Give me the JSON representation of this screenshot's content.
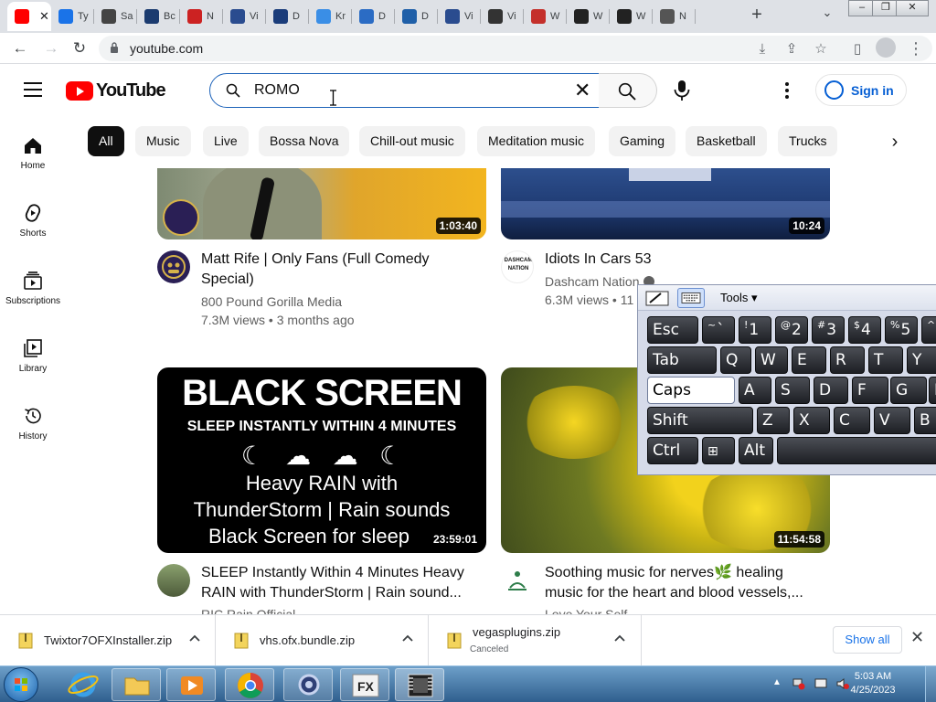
{
  "browser": {
    "tabs": [
      {
        "label": "",
        "favicon_color": "#ff0000",
        "active": true
      },
      {
        "label": "Ty",
        "favicon_color": "#1a73e8",
        "active": false
      },
      {
        "label": "Sa",
        "favicon_color": "#444444",
        "active": false
      },
      {
        "label": "Bc",
        "favicon_color": "#1b3b6f",
        "active": false
      },
      {
        "label": "N",
        "favicon_color": "#cc2222",
        "active": false
      },
      {
        "label": "Vi",
        "favicon_color": "#2a4c8f",
        "active": false
      },
      {
        "label": "D",
        "favicon_color": "#1a3c7a",
        "active": false
      },
      {
        "label": "Kr",
        "favicon_color": "#3a8ee6",
        "active": false
      },
      {
        "label": "D",
        "favicon_color": "#2b6cc4",
        "active": false
      },
      {
        "label": "D",
        "favicon_color": "#1f5fa8",
        "active": false
      },
      {
        "label": "Vi",
        "favicon_color": "#2a4c8f",
        "active": false
      },
      {
        "label": "Vi",
        "favicon_color": "#333333",
        "active": false
      },
      {
        "label": "W",
        "favicon_color": "#c4302b",
        "active": false
      },
      {
        "label": "W",
        "favicon_color": "#222222",
        "active": false
      },
      {
        "label": "W",
        "favicon_color": "#222222",
        "active": false
      },
      {
        "label": "N",
        "favicon_color": "#555555",
        "active": false
      }
    ],
    "url": "youtube.com",
    "new_tab_symbol": "+"
  },
  "youtube": {
    "logo_text": "YouTube",
    "search": {
      "value": "ROMO"
    },
    "signin_label": "Sign in",
    "chips": [
      "All",
      "Music",
      "Live",
      "Bossa Nova",
      "Chill-out music",
      "Meditation music",
      "Gaming",
      "Basketball",
      "Trucks"
    ],
    "guide": [
      {
        "label": "Home",
        "icon": "home-icon"
      },
      {
        "label": "Shorts",
        "icon": "shorts-icon"
      },
      {
        "label": "Subscriptions",
        "icon": "subscriptions-icon"
      },
      {
        "label": "Library",
        "icon": "library-icon"
      },
      {
        "label": "History",
        "icon": "history-icon"
      }
    ],
    "videos": [
      {
        "title": "Matt Rife | Only Fans (Full Comedy Special)",
        "channel": "800 Pound Gorilla Media",
        "meta": "7.3M views • 3 months ago",
        "duration": "1:03:40"
      },
      {
        "title": "Idiots In Cars 53",
        "channel": "Dashcam Nation",
        "meta": "6.3M views • 11",
        "duration": "10:24",
        "avatar_text": "DASHCAM NATION"
      },
      {
        "title": "SLEEP Instantly Within 4 Minutes Heavy RAIN with ThunderStorm | Rain sound...",
        "channel": "RIC Rain Official",
        "meta": "",
        "duration": "23:59:01",
        "thumb_lines": [
          "BLACK SCREEN",
          "SLEEP INSTANTLY WITHIN 4 MINUTES",
          "Heavy RAIN with",
          "ThunderStorm | Rain sounds",
          "Black Screen for sleep"
        ]
      },
      {
        "title": "Soothing music for nerves🌿 healing music for the heart and blood vessels,...",
        "channel": "Love Your Self",
        "meta": "",
        "duration": "11:54:58"
      }
    ]
  },
  "keyboard": {
    "tools_label": "Tools",
    "rows": [
      [
        {
          "main": "Esc"
        },
        {
          "sup": "~",
          "main": "`"
        },
        {
          "sup": "!",
          "main": "1"
        },
        {
          "sup": "@",
          "main": "2"
        },
        {
          "sup": "#",
          "main": "3"
        },
        {
          "sup": "$",
          "main": "4"
        },
        {
          "sup": "%",
          "main": "5"
        },
        {
          "sup": "^",
          "main": ""
        }
      ],
      [
        {
          "main": "Tab"
        },
        {
          "main": "Q"
        },
        {
          "main": "W"
        },
        {
          "main": "E"
        },
        {
          "main": "R"
        },
        {
          "main": "T"
        },
        {
          "main": "Y"
        }
      ],
      [
        {
          "main": "Caps"
        },
        {
          "main": "A"
        },
        {
          "main": "S"
        },
        {
          "main": "D"
        },
        {
          "main": "F"
        },
        {
          "main": "G"
        },
        {
          "main": "H"
        }
      ],
      [
        {
          "main": "Shift"
        },
        {
          "main": "Z"
        },
        {
          "main": "X"
        },
        {
          "main": "C"
        },
        {
          "main": "V"
        },
        {
          "main": "B"
        }
      ],
      [
        {
          "main": "Ctrl"
        },
        {
          "main": ""
        },
        {
          "main": "Alt"
        },
        {
          "main": ""
        }
      ]
    ]
  },
  "downloads": {
    "items": [
      {
        "name": "Twixtor7OFXInstaller.zip",
        "status": ""
      },
      {
        "name": "vhs.ofx.bundle.zip",
        "status": ""
      },
      {
        "name": "vegasplugins.zip",
        "status": "Canceled"
      }
    ],
    "show_all_label": "Show all"
  },
  "taskbar": {
    "time": "5:03 AM",
    "date": "4/25/2023"
  }
}
